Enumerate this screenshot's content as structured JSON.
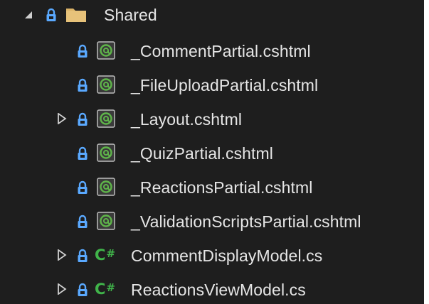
{
  "folder": {
    "name": "Shared",
    "expanded": true
  },
  "items": [
    {
      "name": "_CommentPartial.cshtml",
      "kind": "razor",
      "expandable": false
    },
    {
      "name": "_FileUploadPartial.cshtml",
      "kind": "razor",
      "expandable": false
    },
    {
      "name": "_Layout.cshtml",
      "kind": "razor",
      "expandable": true
    },
    {
      "name": "_QuizPartial.cshtml",
      "kind": "razor",
      "expandable": false
    },
    {
      "name": "_ReactionsPartial.cshtml",
      "kind": "razor",
      "expandable": false
    },
    {
      "name": "_ValidationScriptsPartial.cshtml",
      "kind": "razor",
      "expandable": false
    },
    {
      "name": "CommentDisplayModel.cs",
      "kind": "csharp",
      "expandable": true
    },
    {
      "name": "ReactionsViewModel.cs",
      "kind": "csharp",
      "expandable": true
    }
  ],
  "icons": {
    "expanded": "triangle-expanded-icon",
    "collapsed": "triangle-collapsed-icon",
    "lock": "lock-icon",
    "folder": "folder-icon",
    "razor": "razor-file-icon",
    "csharp": "csharp-file-icon",
    "csharp_glyph": "C",
    "csharp_hash": "#"
  },
  "colors": {
    "background": "#1e1e1e",
    "text": "#e6e6e6",
    "lock": "#5aa9ff",
    "folder": "#dcb468",
    "razor_green": "#5fb54a",
    "csharp_green": "#40b44a",
    "expander": "#cfcfcf"
  }
}
